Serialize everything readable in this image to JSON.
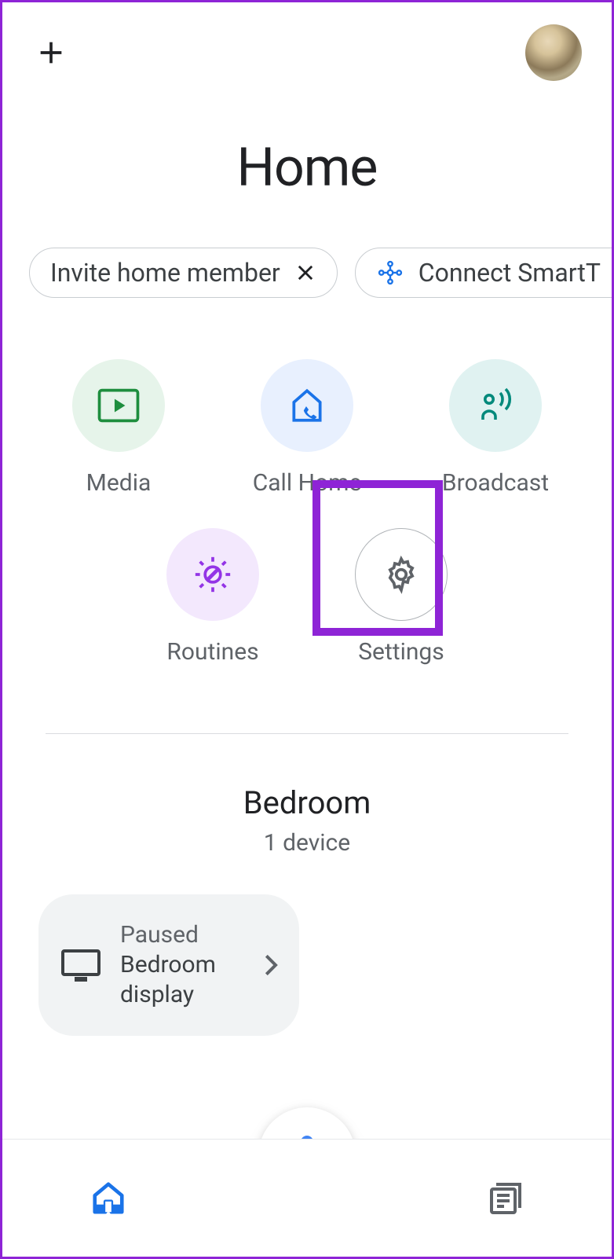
{
  "header": {
    "title": "Home"
  },
  "chips": [
    {
      "label": "Invite home member",
      "closeable": true
    },
    {
      "label": "Connect SmartT",
      "icon": "network"
    }
  ],
  "actions": [
    {
      "id": "media",
      "label": "Media",
      "circle": "c-media",
      "icon": "play-media-icon"
    },
    {
      "id": "call-home",
      "label": "Call Home",
      "circle": "c-call",
      "icon": "call-home-icon"
    },
    {
      "id": "broadcast",
      "label": "Broadcast",
      "circle": "c-broad",
      "icon": "broadcast-icon"
    },
    {
      "id": "routines",
      "label": "Routines",
      "circle": "c-rout",
      "icon": "routines-icon"
    },
    {
      "id": "settings",
      "label": "Settings",
      "circle": "c-sett",
      "icon": "gear-icon",
      "highlighted": true
    }
  ],
  "room": {
    "name": "Bedroom",
    "device_count_label": "1 device",
    "devices": [
      {
        "status": "Paused",
        "name": "Bedroom display"
      }
    ]
  },
  "nav": {
    "home": "home-icon",
    "feed": "feed-icon",
    "mic": "mic-icon"
  }
}
